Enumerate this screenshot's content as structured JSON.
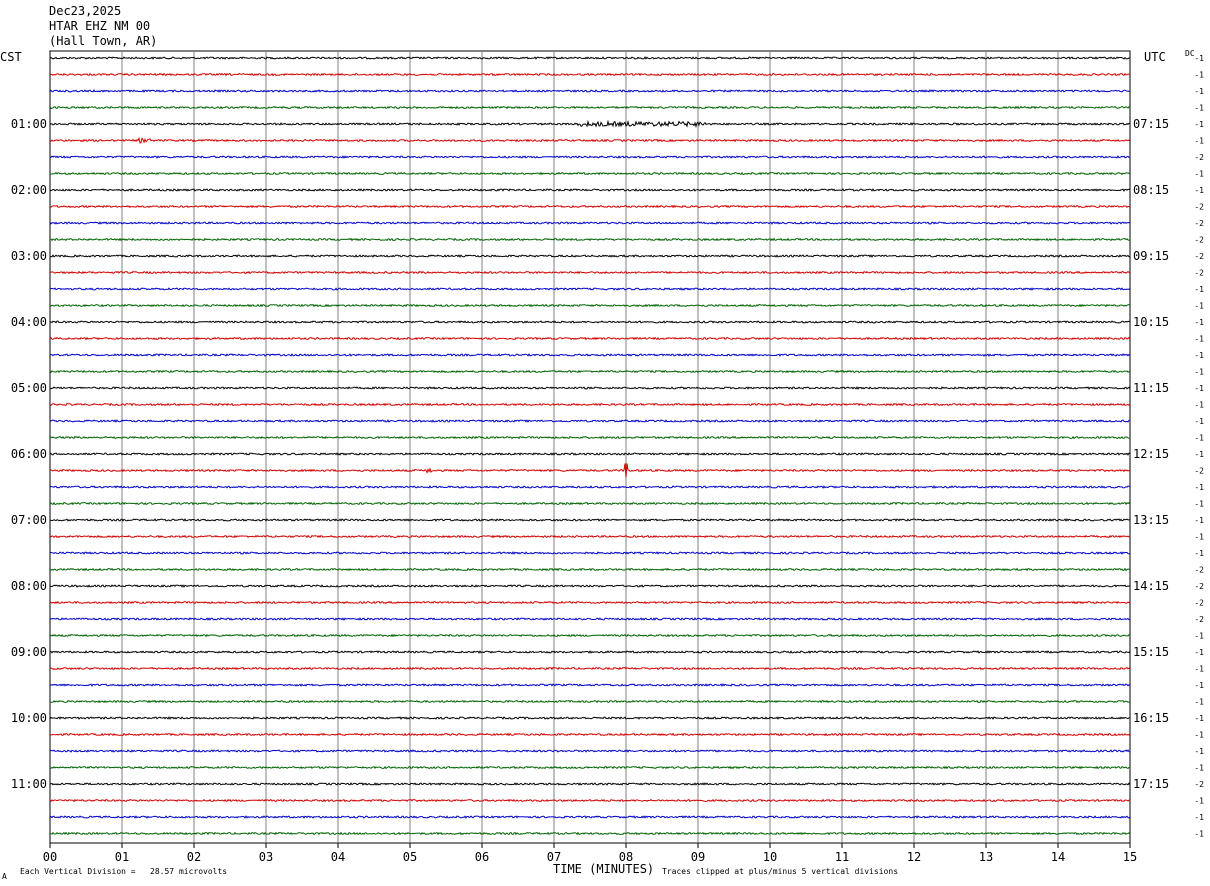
{
  "header": {
    "date": "Dec23,2025",
    "station": "HTAR EHZ NM 00",
    "location": "(Hall Town, AR)"
  },
  "left_axis_label": "CST",
  "right_axis_label": "UTC",
  "dc_label": "DC",
  "footer": {
    "scale_note": "Each Vertical Division =   28.57 microvolts",
    "xlabel": "TIME (MINUTES)",
    "clip_note": "Traces clipped at plus/minus 5 vertical divisions",
    "corner_mark": "A"
  },
  "colors": {
    "trace_cycle": [
      "#000000",
      "#d40000",
      "#0000c8",
      "#006400"
    ],
    "grid": "#808080"
  },
  "chart_data": {
    "type": "line",
    "xlabel": "TIME (MINUTES)",
    "xlim": [
      0,
      15
    ],
    "x_ticks": [
      "00",
      "01",
      "02",
      "03",
      "04",
      "05",
      "06",
      "07",
      "08",
      "09",
      "10",
      "11",
      "12",
      "13",
      "14",
      "15"
    ],
    "left_hour_labels": [
      "01:00",
      "02:00",
      "03:00",
      "04:00",
      "05:00",
      "06:00",
      "07:00",
      "08:00",
      "09:00",
      "10:00",
      "11:00"
    ],
    "right_hour_labels": [
      "07:15",
      "08:15",
      "09:15",
      "10:15",
      "11:15",
      "12:15",
      "13:15",
      "14:15",
      "15:15",
      "16:15",
      "17:15"
    ],
    "trace_count": 48,
    "dc_offsets": [
      "-1",
      "-1",
      "-1",
      "-1",
      "-1",
      "-1",
      "-2",
      "-1",
      "-1",
      "-2",
      "-2",
      "-2",
      "-2",
      "-2",
      "-1",
      "-1",
      "-1",
      "-1",
      "-1",
      "-1",
      "-1",
      "-1",
      "-1",
      "-1",
      "-1",
      "-2",
      "-1",
      "-1",
      "-1",
      "-1",
      "-1",
      "-2",
      "-2",
      "-2",
      "-2",
      "-1",
      "-1",
      "-1",
      "-1",
      "-1",
      "-1",
      "-1",
      "-1",
      "-1",
      "-2",
      "-1",
      "-1",
      "-1"
    ],
    "events": [
      {
        "trace": 4,
        "minute_start": 7.3,
        "minute_end": 9.1,
        "note": "slightly elevated amplitude"
      },
      {
        "trace": 5,
        "minute_start": 1.2,
        "minute_end": 1.4,
        "note": "small burst"
      },
      {
        "trace": 25,
        "minute_start": 5.2,
        "minute_end": 5.3,
        "note": "small burst"
      },
      {
        "trace": 25,
        "minute_start": 8.0,
        "minute_end": 8.05,
        "note": "spike"
      }
    ]
  }
}
